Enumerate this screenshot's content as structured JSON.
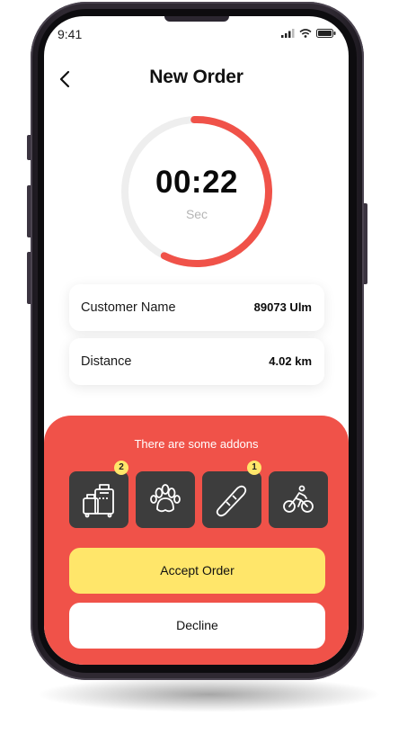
{
  "status_bar": {
    "time": "9:41",
    "icons": [
      "signal-icon",
      "wifi-icon",
      "battery-icon"
    ]
  },
  "header": {
    "back_icon": "chevron-left-icon",
    "title": "New Order"
  },
  "timer": {
    "value": "00:22",
    "unit": "Sec",
    "progress": 0.58,
    "colors": {
      "progress": "#f05249",
      "track": "#eeeeee"
    }
  },
  "details": [
    {
      "label": "Customer Name",
      "value": "89073 Ulm"
    },
    {
      "label": "Distance",
      "value": "4.02 km"
    }
  ],
  "addons": {
    "title": "There are some addons",
    "items": [
      {
        "icon": "luggage-icon",
        "badge": "2"
      },
      {
        "icon": "paw-icon",
        "badge": ""
      },
      {
        "icon": "snowboard-icon",
        "badge": "1"
      },
      {
        "icon": "bicycle-icon",
        "badge": ""
      }
    ]
  },
  "actions": {
    "accept_label": "Accept Order",
    "decline_label": "Decline"
  },
  "colors": {
    "accent": "#f05249",
    "accept": "#ffe66a",
    "tile": "#3d3d3d"
  }
}
